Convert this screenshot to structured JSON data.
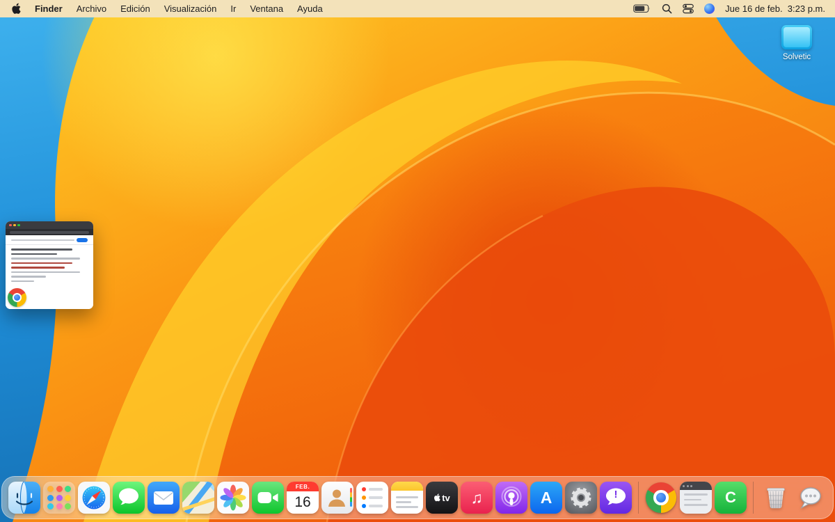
{
  "theme": {
    "menubar-tint": "#f3e2ba",
    "dock-tint": "rgba(255,255,255,0.34)",
    "system-red": "#ff3b30",
    "system-blue": "#1a73e8"
  },
  "menu_bar": {
    "apple_icon": "apple-logo-icon",
    "active_app": "Finder",
    "items": [
      "Finder",
      "Archivo",
      "Edición",
      "Visualización",
      "Ir",
      "Ventana",
      "Ayuda"
    ],
    "status_icons": [
      "battery-icon",
      "spotlight-search-icon",
      "control-center-icon",
      "siri-icon"
    ],
    "clock": "Jue 16 de feb.  3:23 p.m."
  },
  "desktop": {
    "wallpaper": "macos-ventura-orange-bloom",
    "icons": [
      {
        "label": "Solvetic",
        "icon": "display-drive-icon"
      }
    ],
    "minimized_window": {
      "app_badge_icon": "chrome-icon"
    }
  },
  "dock": {
    "items": [
      "finder",
      "launchpad",
      "safari",
      "messages",
      "mail",
      "maps",
      "photos",
      "facetime",
      "calendar",
      "contacts",
      "reminders",
      "notes",
      "apple-tv",
      "music",
      "podcasts",
      "app-store",
      "system-settings",
      "feedback-assistant",
      "chrome",
      "app-window",
      "cleaner",
      "trash",
      "chat-bubble"
    ],
    "calendar": {
      "month": "FEB.",
      "day": "16"
    },
    "tv_label": "tv",
    "music_glyph": "♫",
    "appstore_letter": "A",
    "cleaner_letter": "C",
    "feedback_glyph": "!"
  }
}
